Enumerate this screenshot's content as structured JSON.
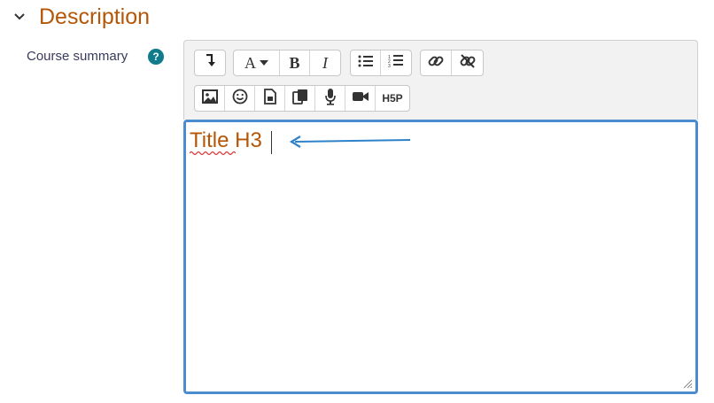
{
  "section": {
    "title": "Description",
    "chevron_icon": "chevron-down-icon"
  },
  "field": {
    "label": "Course summary",
    "help_icon": "question-help-icon",
    "help_glyph": "?"
  },
  "toolbar": {
    "row1": [
      {
        "name": "collapse-toolbar-button",
        "icon": "arrow-down-return-icon"
      },
      {
        "name": "font-style-button",
        "icon": "font-A-dropdown-icon",
        "label": "A"
      },
      {
        "name": "bold-button",
        "icon": "bold-icon",
        "label": "B"
      },
      {
        "name": "italic-button",
        "icon": "italic-icon",
        "label": "I"
      },
      {
        "name": "unordered-list-button",
        "icon": "bullet-list-icon"
      },
      {
        "name": "ordered-list-button",
        "icon": "numbered-list-icon"
      },
      {
        "name": "link-button",
        "icon": "link-icon"
      },
      {
        "name": "unlink-button",
        "icon": "unlink-icon"
      }
    ],
    "row2": [
      {
        "name": "image-button",
        "icon": "image-icon"
      },
      {
        "name": "emoji-button",
        "icon": "smiley-icon"
      },
      {
        "name": "media-button",
        "icon": "file-media-icon"
      },
      {
        "name": "manage-files-button",
        "icon": "copy-files-icon"
      },
      {
        "name": "record-audio-button",
        "icon": "microphone-icon"
      },
      {
        "name": "record-video-button",
        "icon": "video-camera-icon"
      },
      {
        "name": "h5p-button",
        "icon": "h5p-icon",
        "label": "H5P"
      }
    ]
  },
  "editor": {
    "content": "Title H3",
    "accent_color": "#4a8ccf",
    "text_color": "#b55606"
  },
  "colors": {
    "heading": "#b55606",
    "help_badge": "#0f7b8c",
    "arrow": "#2e82c9"
  }
}
